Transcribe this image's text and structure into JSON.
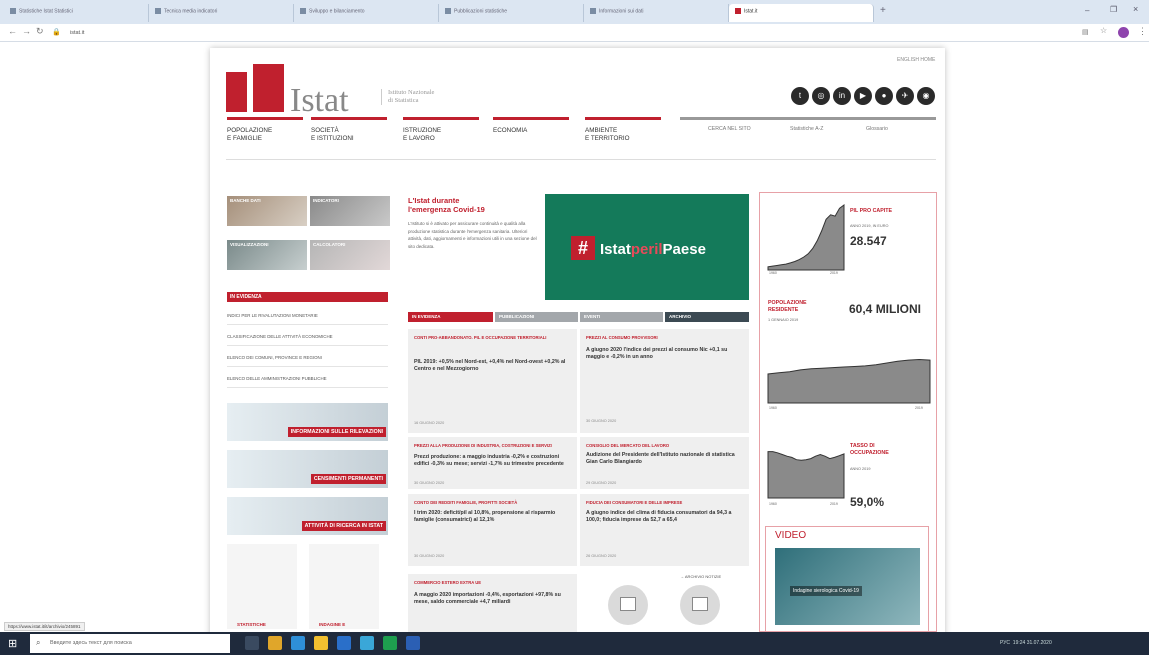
{
  "browser": {
    "tabs": [
      {
        "label": "Statisti­che Istat Statistici",
        "active": false
      },
      {
        "label": "Tecnica media indicatori",
        "active": false
      },
      {
        "label": "Sviluppo e bilanciamento",
        "active": false
      },
      {
        "label": "Pubblicazioni statistiche",
        "active": false
      },
      {
        "label": "Informazioni sui dati",
        "active": false
      },
      {
        "label": "Istat.it",
        "active": true
      }
    ],
    "new_tab": "+",
    "url": "istat.it",
    "status_url": "https://www.istat.it/it/archivio/245891"
  },
  "header": {
    "english_home": "ENGLISH HOME",
    "logo_text": "Istat",
    "logo_sub_1": "Istituto Nazionale",
    "logo_sub_2": "di Statistica",
    "social": [
      "twitter",
      "instagram",
      "linkedin",
      "youtube",
      "flickr",
      "telegram",
      "rss"
    ]
  },
  "nav": {
    "items": [
      {
        "l1": "POPOLAZIONE",
        "l2": "E FAMIGLIE"
      },
      {
        "l1": "SOCIETÀ",
        "l2": "E ISTITUZIONI"
      },
      {
        "l1": "ISTRUZIONE",
        "l2": "E LAVORO"
      },
      {
        "l1": "ECONOMIA",
        "l2": ""
      },
      {
        "l1": "AMBIENTE",
        "l2": "E TERRITORIO"
      }
    ],
    "secondary": [
      "CERCA NEL SITO",
      "Statistiche A-Z",
      "Glossario"
    ]
  },
  "left": {
    "tiles": [
      "BANCHE DATI",
      "INDICATORI",
      "VISUALIZZAZIONI",
      "CALCOLATORI"
    ],
    "in_evidenza": "IN EVIDENZA",
    "links": [
      "INDICI PER LE RIVALUTAZIONI MONETARIE",
      "CLASSIFICAZIONE DELLE ATTIVITÀ ECONOMICHE",
      "ELENCO DEI COMUNI, PROVINCE E REGIONI",
      "ELENCO DELLE AMMINISTRAZIONI PUBBLICHE"
    ],
    "banners": [
      "INFORMAZIONI SULLE RILEVAZIONI",
      "CENSIMENTI PERMANENTI",
      "ATTIVITÀ DI RICERCA IN ISTAT"
    ],
    "bottom_1": "STATISTICHE",
    "bottom_2": "INDAGINE E"
  },
  "covid": {
    "title_1": "L'Istat durante",
    "title_2": "l'emergenza Covid-19",
    "text": "L'Istituto si è attivato per assicurare continuità e qualità alla produzione statistica durante l'emergenza sanitaria. Ulteriori attività, dati, aggiornamenti e informazioni utili in una sezione del sito dedicata.",
    "hash": "#",
    "hashtag_1": "Istat",
    "hashtag_2": "per",
    "hashtag_3": "il",
    "hashtag_4": "Paese"
  },
  "news": {
    "tabs": [
      "IN EVIDENZA",
      "PUBBLICAZIONI",
      "EVENTI",
      "ARCHIVIO"
    ],
    "cards": [
      {
        "cat": "CONTI PRO-ABBANDONATO. PIL E OCCUPAZIONE TERRITORIALI",
        "body": "PIL 2019: +0,5% nel Nord-est, +0,4% nel Nord-ovest +0,2% al Centro e nel Mezzogiorno",
        "date": "16 GIUGNO 2020"
      },
      {
        "cat": "PREZZI AL CONSUMO PROVVISORI",
        "body": "A giugno 2020 l'indice dei prezzi al consumo Nic +0,1 su maggio e -0,2% in un anno",
        "date": "30 GIUGNO 2020"
      },
      {
        "cat": "PREZZI ALLA PRODUZIONE DI INDUSTRIA, COSTRUZIONI E SERVIZI",
        "body": "Prezzi produzione: a maggio industria -0,2% e costruzioni edifici -0,3% su mese; servizi -1,7% su trimestre precedente",
        "date": "30 GIUGNO 2020"
      },
      {
        "cat": "CONSIGLIO DEL MERCATO DEL LAVORO",
        "body": "Audizione del Presidente dell'Istituto nazionale di statistica Gian Carlo Blangiardo",
        "date": "29 GIUGNO 2020"
      },
      {
        "cat": "CONTO DEI REDDITI FAMIGLIE, PROFITTI SOCIETÀ",
        "body": "I trim 2020: deficit/pil al 10,8%, propensione al risparmio famiglie (consumatrici) al 12,1%",
        "date": "30 GIUGNO 2020"
      },
      {
        "cat": "FIDUCIA DEI CONSUMATORI E DELLE IMPRESE",
        "body": "A giugno indice del clima di fiducia consumatori da 94,3 a 100,0; fiducia imprese da 52,7 a 65,4",
        "date": "26 GIUGNO 2020"
      },
      {
        "cat": "COMMERCIO ESTERO EXTRA UE",
        "body": "A maggio 2020 importazioni -0,4%, esportazioni +97,8% su mese, saldo commerciale +4,7 miliardi",
        "date": ""
      }
    ],
    "archivio": "ARCHIVIO NOTIZIE"
  },
  "right": {
    "pil": {
      "label_1": "PIL PRO CAPITE",
      "sub": "ANNO 2019, IN EURO",
      "value": "28.547",
      "x_start": "1960",
      "x_end": "2019",
      "series": [
        0.05,
        0.06,
        0.07,
        0.08,
        0.09,
        0.11,
        0.13,
        0.16,
        0.2,
        0.25,
        0.33,
        0.45,
        0.6,
        0.78,
        0.85,
        0.83,
        0.95,
        1.0
      ]
    },
    "pop": {
      "label_1": "POPOLAZIONE",
      "label_2": "RESIDENTE",
      "sub": "1 GENNAIO 2019",
      "value": "60,4 MILIONI",
      "x_start": "1960",
      "x_end": "2019",
      "series": [
        0.5,
        0.52,
        0.54,
        0.57,
        0.59,
        0.6,
        0.61,
        0.62,
        0.63,
        0.64,
        0.66,
        0.69,
        0.72,
        0.74,
        0.75,
        0.74
      ]
    },
    "occ": {
      "label_1": "TASSO DI",
      "label_2": "OCCUPAZIONE",
      "sub": "ANNO 2019",
      "value": "59,0%",
      "x_start": "1960",
      "x_end": "2019",
      "series": [
        0.8,
        0.8,
        0.78,
        0.75,
        0.72,
        0.7,
        0.66,
        0.65,
        0.66,
        0.68,
        0.72,
        0.75,
        0.72,
        0.68,
        0.7,
        0.73,
        0.76
      ]
    },
    "video_title": "VIDEO",
    "video_caption": "Indagine sierologica Covid-19",
    "accent": "#c0202e"
  },
  "taskbar": {
    "search_placeholder": "Введите здесь текст для поиска",
    "time": "19:24",
    "date": "31.07.2020",
    "lang": "РУС"
  }
}
